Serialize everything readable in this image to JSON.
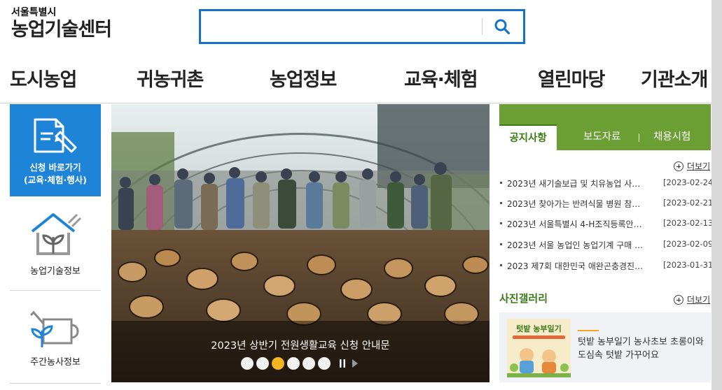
{
  "header": {
    "logo_sub": "서울특별시",
    "logo_main": "농업기술센터",
    "search": {
      "value": "",
      "placeholder": ""
    }
  },
  "gnb": [
    "도시농업",
    "귀농귀촌",
    "농업정보",
    "교육·체험",
    "열린마당",
    "기관소개"
  ],
  "quick_menu": {
    "apply": {
      "line1": "신청 바로가기",
      "line2": "(교육·체험·행사)"
    },
    "farm_tech": "농업기술정보",
    "weekly": "주간농사정보"
  },
  "visual": {
    "caption": "2023년 상반기 전원생활교육 신청 안내문",
    "slide_count": 6,
    "active_slide": 3
  },
  "notice": {
    "tabs": [
      "공지사항",
      "보도자료",
      "채용시험"
    ],
    "more": "더보기",
    "items": [
      {
        "title": "2023년 새기술보급 및 치유농업 사…",
        "date": "[2023-02-24]"
      },
      {
        "title": "2023년 찾아가는 반려식물 병원 참…",
        "date": "[2023-02-21]"
      },
      {
        "title": "2023년 서울특별시 4-H조직등록안…",
        "date": "[2023-02-13]"
      },
      {
        "title": "2023년 서울 농업인 농업기계 구매 …",
        "date": "[2023-02-09]"
      },
      {
        "title": "2023 제7회 대한민국 애완곤충경진…",
        "date": "[2023-01-31]"
      }
    ]
  },
  "gallery": {
    "title": "사진갤러리",
    "more": "더보기",
    "thumb_text": "텃밭 농부일기",
    "text": "텃밭 농부일기 농사초보 초롱이와 도심속 텃밭 가꾸어요"
  },
  "colors": {
    "brand_blue": "#1e84d8",
    "green": "#6b9e33",
    "accent_yellow": "#f3b520"
  }
}
